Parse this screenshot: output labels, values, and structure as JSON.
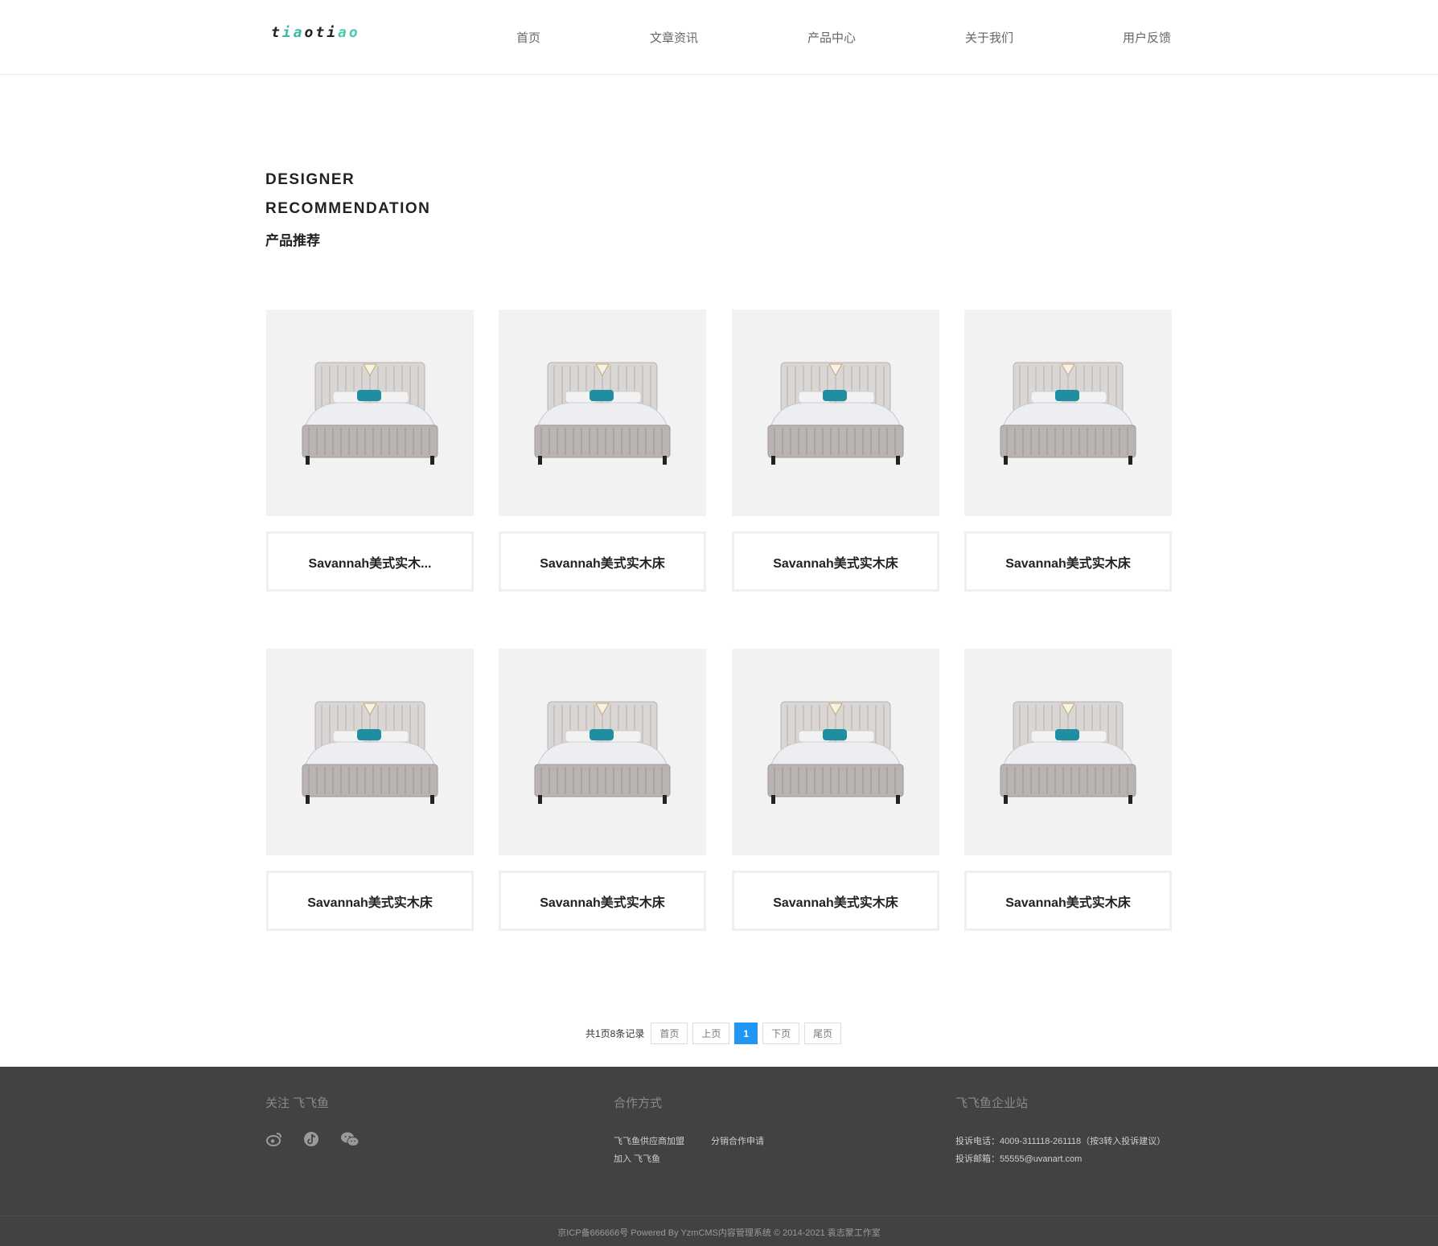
{
  "header": {
    "logo": {
      "p1": "t",
      "p2": "ia",
      "p3": "oti",
      "p4": "ao"
    },
    "nav": [
      "首页",
      "文章资讯",
      "产品中心",
      "关于我们",
      "用户反馈"
    ]
  },
  "section": {
    "title_en_1": "DESIGNER",
    "title_en_2": "RECOMMENDATION",
    "title_cn": "产品推荐"
  },
  "products": [
    {
      "name": "Savannah美式实木..."
    },
    {
      "name": "Savannah美式实木床"
    },
    {
      "name": "Savannah美式实木床"
    },
    {
      "name": "Savannah美式实木床"
    },
    {
      "name": "Savannah美式实木床"
    },
    {
      "name": "Savannah美式实木床"
    },
    {
      "name": "Savannah美式实木床"
    },
    {
      "name": "Savannah美式实木床"
    }
  ],
  "pagination": {
    "info": "共1页8条记录",
    "first": "首页",
    "prev": "上页",
    "current": "1",
    "next": "下页",
    "last": "尾页"
  },
  "footer": {
    "follow_title": "关注 飞飞鱼",
    "social_icons": [
      "weibo-icon",
      "douyin-icon",
      "wechat-icon"
    ],
    "coop_title": "合作方式",
    "coop_links": [
      "飞飞鱼供应商加盟",
      "分销合作申请",
      "加入 飞飞鱼"
    ],
    "site_title": "飞飞鱼企业站",
    "phone": "投诉电话：4009-311118-261118（按3转入投诉建议）",
    "email": "投诉邮箱：55555@uvanart.com",
    "copyright": "京ICP备666666号 Powered By YzmCMS内容管理系统 © 2014-2021 袁志蒙工作室"
  },
  "colors": {
    "accent_blue": "#2196f3",
    "logo_teal": "#3bb8a8",
    "footer_bg": "#424242",
    "card_img_bg": "#f2f2f2"
  }
}
